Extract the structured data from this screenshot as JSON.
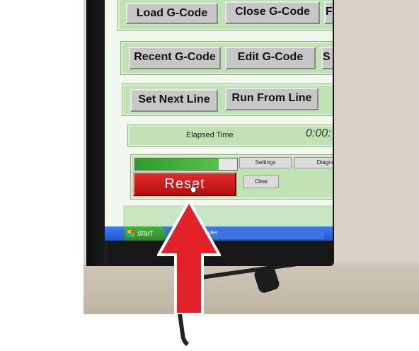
{
  "rows": [
    {
      "buttons": [
        "Load G-Code",
        "Close G-Code",
        "F"
      ]
    },
    {
      "buttons": [
        "Recent G-Code",
        "Edit G-Code",
        "S"
      ]
    },
    {
      "buttons": [
        "Set Next Line",
        "Run From Line"
      ]
    }
  ],
  "elapsed": {
    "label": "Elapsed Time",
    "value": "0:00:"
  },
  "controls": {
    "settings_label": "Settings",
    "diagnostics_label": "Diagnos",
    "clear_label": "Clear",
    "reset_label": "Reset",
    "progress_fraction": 0.82
  },
  "taskbar": {
    "start_label": "start",
    "task_label": "ontroller"
  },
  "colors": {
    "panel": "#bfe3b4",
    "reset": "#d21e1e",
    "arrow": "#e3212b",
    "taskbar": "#2a63e0"
  },
  "icons": {
    "cursor": "hand-pointer-icon",
    "start": "windows-logo-icon",
    "arrow": "red-arrow-annotation"
  }
}
